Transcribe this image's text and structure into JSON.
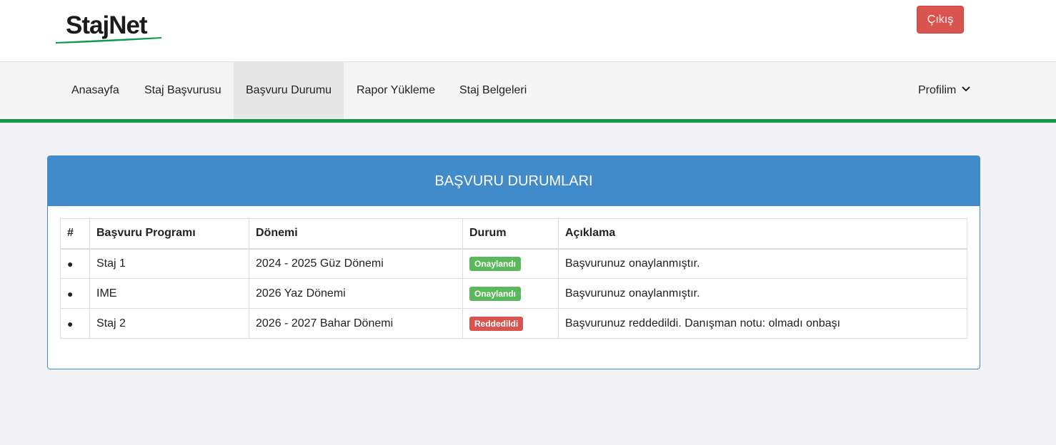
{
  "header": {
    "logo_text": "StajNet",
    "logout_label": "Çıkış"
  },
  "nav": {
    "items": [
      {
        "label": "Anasayfa"
      },
      {
        "label": "Staj Başvurusu"
      },
      {
        "label": "Başvuru Durumu"
      },
      {
        "label": "Rapor Yükleme"
      },
      {
        "label": "Staj Belgeleri"
      }
    ],
    "active": "Başvuru Durumu",
    "profile_label": "Profilim"
  },
  "panel": {
    "title": "BAŞVURU DURUMLARI",
    "columns": [
      "#",
      "Başvuru Programı",
      "Dönemi",
      "Durum",
      "Açıklama"
    ],
    "rows": [
      {
        "marker": "●",
        "program": "Staj 1",
        "period": "2024 - 2025 Güz Dönemi",
        "status": "Onaylandı",
        "status_type": "approved",
        "note": "Başvurunuz onaylanmıştır."
      },
      {
        "marker": "●",
        "program": "IME",
        "period": "2026 Yaz Dönemi",
        "status": "Onaylandı",
        "status_type": "approved",
        "note": "Başvurunuz onaylanmıştır."
      },
      {
        "marker": "●",
        "program": "Staj 2",
        "period": "2026 - 2027 Bahar Dönemi",
        "status": "Reddedildi",
        "status_type": "rejected",
        "note": "Başvurunuz reddedildi. Danışman notu: olmadı onbaşı"
      }
    ]
  },
  "colors": {
    "primary": "#428bca",
    "accent_line": "#0e9a4b",
    "approved": "#5cb85c",
    "rejected": "#d9534f"
  }
}
